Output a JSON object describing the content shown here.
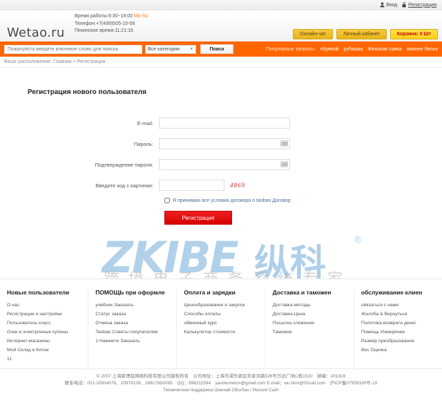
{
  "topbar": {
    "login": "Вход",
    "register": "Регистрация",
    "login_icon": "user-icon",
    "register_icon": "lock-icon"
  },
  "header": {
    "logo": "Wetao.ru",
    "work_hours_label": "Время работы:9:30~18:00",
    "work_hours_days": "Mo-Su",
    "phone": "Телефон:+7(499)505-15-58",
    "beijing_time": "Пекинское время:11:21:16",
    "buttons": [
      {
        "label": "Онлайн-чат",
        "type": "normal"
      },
      {
        "label": "Личный кабинет",
        "type": "normal"
      },
      {
        "label": "Корзина: 0 Шт",
        "type": "cart"
      }
    ]
  },
  "search": {
    "placeholder": "Пожалуйста введите ключевое слово для поиска",
    "value": "",
    "category": "Все категории",
    "button": "Поиск",
    "popular_label": "Популярные запросы:",
    "popular_items": [
      "обувной",
      "рубашка",
      "Женская сумка",
      "нижнее белье"
    ]
  },
  "breadcrumb": {
    "prefix": "Ваше расположение:",
    "home": "Главная",
    "separator": ">",
    "current": "Регистрация"
  },
  "page": {
    "title": "Регистрация нового пользователя"
  },
  "form": {
    "email_label": "E-mail:",
    "email_value": "",
    "password_label": "Пароль:",
    "password_value": "",
    "confirm_label": "Подтверждение пароля:",
    "confirm_value": "",
    "captcha_label": "Введите код с картинки:",
    "captcha_value": "",
    "captcha_code": "4869",
    "agree_text": "Я принимаю все условия договора о taobao Договор",
    "submit_label": "Регистрация"
  },
  "watermark": {
    "brand": "ZKIBE",
    "brand_cn": "纵科",
    "registered": "®",
    "tagline": "跨境电子商务系统专家"
  },
  "footer": {
    "columns": [
      {
        "title": "Новые пользователи",
        "links": [
          "О нас",
          "Регистрация и настройки",
          "Пользователь класс",
          "Очки и электронные купоны",
          "Интернет-магазины",
          "Мой Склад в Китае",
          "11"
        ]
      },
      {
        "title": "ПОМОЩЬ при оформле",
        "links": [
          "учебник Заказать",
          "Статус заказа",
          "Отмена заказа",
          "Taobao Советы покупателям",
          "1 Нажмите Заказать"
        ]
      },
      {
        "title": "Оплата и зарядки",
        "links": [
          "Ценообразование и закупок",
          "Способы оплаты",
          "обменный курс",
          "Калькулятор стоимости"
        ]
      },
      {
        "title": "Доставка и таможен",
        "links": [
          "Доставка методы",
          "Доставка Цена",
          "Посылка слежения",
          "Таможня"
        ]
      },
      {
        "title": "обслуживание клиен",
        "links": [
          "связаться с нами",
          "Жалоба & Вернуться",
          "Политика возврата денег",
          "Помощь Измерение",
          "Размер преобразования",
          "Вес Оценка"
        ]
      }
    ]
  },
  "copyright": {
    "line1": "© 2007 上海紫博蓝网络科技有限公司版权所有　公司地址：上海市浦东新区年家浜路526号万达广场C栋1510　邮编：201316",
    "line2": "联系电话：021-20934076、20978108、18817650095　QQ：896211594　yandexnetcn@gmail.com E-mail：wu.himi@Gmail.com　沪ICP备07509330号-10",
    "line3": "Техническая поддержка Шанхай ZiБоЛан / Россия Сайт"
  }
}
